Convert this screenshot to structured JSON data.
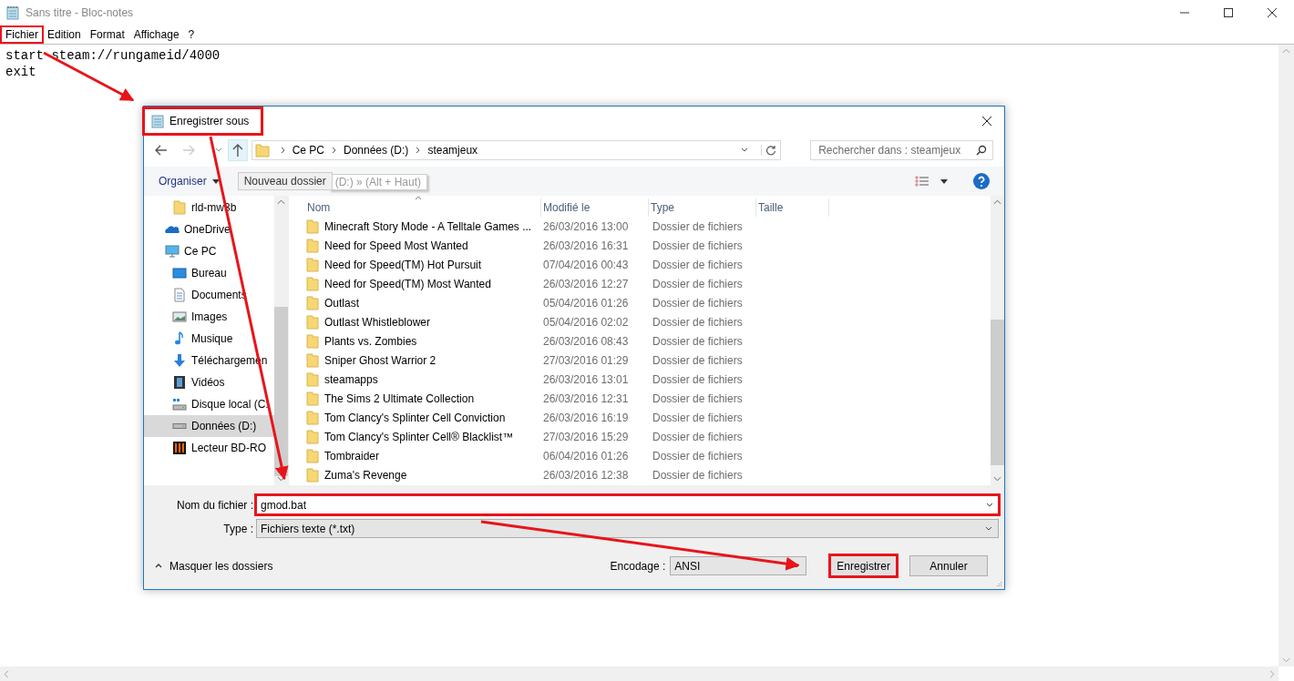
{
  "window": {
    "title": "Sans titre - Bloc-notes"
  },
  "menu": [
    {
      "label": "Fichier",
      "highlighted": true
    },
    {
      "label": "Edition",
      "highlighted": false
    },
    {
      "label": "Format",
      "highlighted": false
    },
    {
      "label": "Affichage",
      "highlighted": false
    },
    {
      "label": "?",
      "highlighted": false
    }
  ],
  "editor": {
    "lines": [
      "start steam://rungameid/4000",
      "exit"
    ]
  },
  "dialog": {
    "title": "Enregistrer sous",
    "title_highlighted": true,
    "breadcrumb": [
      "Ce PC",
      "Données (D:)",
      "steamjeux"
    ],
    "search": {
      "placeholder": "Rechercher dans : steamjeux"
    },
    "toolbar": {
      "organize": "Organiser",
      "new_folder": "Nouveau dossier",
      "tooltip": "(D:) » (Alt + Haut)"
    },
    "sidebar": {
      "items": [
        {
          "label": "rld-mw3b",
          "kind": "folder",
          "selected": false
        },
        {
          "label": "OneDrive",
          "kind": "cloud",
          "selected": false
        },
        {
          "label": "Ce PC",
          "kind": "pc",
          "selected": false,
          "children": [
            {
              "label": "Bureau",
              "kind": "desktop",
              "selected": false
            },
            {
              "label": "Documents",
              "kind": "documents",
              "selected": false
            },
            {
              "label": "Images",
              "kind": "images",
              "selected": false
            },
            {
              "label": "Musique",
              "kind": "music",
              "selected": false
            },
            {
              "label": "Téléchargemen",
              "kind": "download",
              "selected": false
            },
            {
              "label": "Vidéos",
              "kind": "videos",
              "selected": false
            },
            {
              "label": "Disque local (C:",
              "kind": "disk",
              "selected": false
            },
            {
              "label": "Données (D:)",
              "kind": "drive",
              "selected": true
            },
            {
              "label": "Lecteur BD-RO",
              "kind": "bdrom",
              "selected": false
            }
          ]
        }
      ]
    },
    "table": {
      "columns": [
        "Nom",
        "Modifié le",
        "Type",
        "Taille"
      ],
      "rows": [
        [
          "Minecraft Story Mode - A Telltale Games ...",
          "26/03/2016 13:00",
          "Dossier de fichiers"
        ],
        [
          "Need for Speed Most Wanted",
          "26/03/2016 16:31",
          "Dossier de fichiers"
        ],
        [
          "Need for Speed(TM) Hot Pursuit",
          "07/04/2016 00:43",
          "Dossier de fichiers"
        ],
        [
          "Need for Speed(TM) Most Wanted",
          "26/03/2016 12:27",
          "Dossier de fichiers"
        ],
        [
          "Outlast",
          "05/04/2016 01:26",
          "Dossier de fichiers"
        ],
        [
          "Outlast Whistleblower",
          "05/04/2016 02:02",
          "Dossier de fichiers"
        ],
        [
          "Plants vs. Zombies",
          "26/03/2016 08:43",
          "Dossier de fichiers"
        ],
        [
          "Sniper Ghost Warrior 2",
          "27/03/2016 01:29",
          "Dossier de fichiers"
        ],
        [
          "steamapps",
          "26/03/2016 13:01",
          "Dossier de fichiers"
        ],
        [
          "The Sims 2 Ultimate Collection",
          "26/03/2016 12:31",
          "Dossier de fichiers"
        ],
        [
          "Tom Clancy's Splinter Cell Conviction",
          "26/03/2016 16:19",
          "Dossier de fichiers"
        ],
        [
          "Tom Clancy's Splinter Cell® Blacklist™",
          "27/03/2016 15:29",
          "Dossier de fichiers"
        ],
        [
          "Tombraider",
          "06/04/2016 01:26",
          "Dossier de fichiers"
        ],
        [
          "Zuma's Revenge",
          "26/03/2016 12:38",
          "Dossier de fichiers"
        ]
      ]
    },
    "filename": {
      "label": "Nom du fichier :",
      "value": "gmod.bat",
      "highlighted": true
    },
    "type": {
      "label": "Type :",
      "value": "Fichiers texte (*.txt)"
    },
    "hide_folders": "Masquer les dossiers",
    "encoding": {
      "label": "Encodage :",
      "value": "ANSI"
    },
    "buttons": [
      {
        "label": "Enregistrer",
        "highlighted": true
      },
      {
        "label": "Annuler",
        "highlighted": false
      }
    ]
  }
}
